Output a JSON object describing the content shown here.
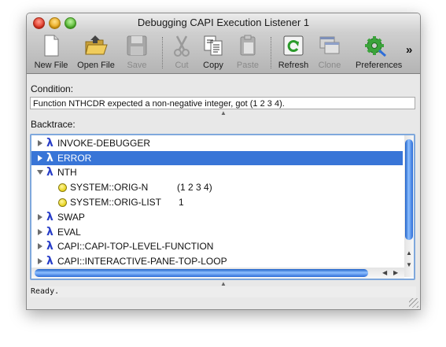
{
  "window": {
    "title": "Debugging CAPI Execution Listener 1"
  },
  "toolbar": {
    "new_file": "New File",
    "open_file": "Open File",
    "save": "Save",
    "cut": "Cut",
    "copy": "Copy",
    "paste": "Paste",
    "refresh": "Refresh",
    "clone": "Clone",
    "preferences": "Preferences",
    "overflow": "»"
  },
  "condition": {
    "label": "Condition:",
    "text": "Function NTHCDR expected a non-negative integer, got (1 2 3 4)."
  },
  "backtrace": {
    "label": "Backtrace:",
    "rows": [
      {
        "text": "INVOKE-DEBUGGER",
        "kind": "frame",
        "expanded": false,
        "selected": false
      },
      {
        "text": "ERROR",
        "kind": "frame",
        "expanded": false,
        "selected": true
      },
      {
        "text": "NTH",
        "kind": "frame",
        "expanded": true,
        "selected": false
      },
      {
        "text": "SYSTEM::ORIG-N",
        "value": "(1 2 3 4)",
        "kind": "var"
      },
      {
        "text": "SYSTEM::ORIG-LIST",
        "value": "1",
        "kind": "var"
      },
      {
        "text": "SWAP",
        "kind": "frame",
        "expanded": false,
        "selected": false
      },
      {
        "text": "EVAL",
        "kind": "frame",
        "expanded": false,
        "selected": false
      },
      {
        "text": "CAPI::CAPI-TOP-LEVEL-FUNCTION",
        "kind": "frame",
        "expanded": false,
        "selected": false
      },
      {
        "text": "CAPI::INTERACTIVE-PANE-TOP-LOOP",
        "kind": "frame",
        "expanded": false,
        "selected": false
      }
    ]
  },
  "status": {
    "text": "Ready."
  },
  "icons": {
    "frame": "lambda-icon",
    "var": "yellow-dot-icon"
  },
  "colors": {
    "selection": "#3875d7",
    "lambda": "#2a3fc8",
    "accent": "#4a8de0"
  }
}
